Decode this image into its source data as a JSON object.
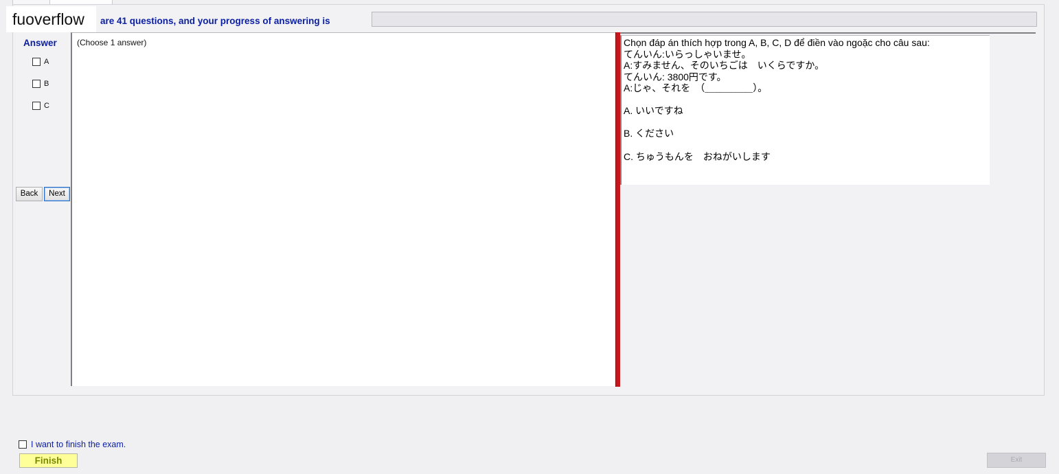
{
  "watermark": "fuoverflow",
  "progress": {
    "label": "are 41 questions, and your progress of answering is",
    "value": 0
  },
  "answer": {
    "title": "Answer",
    "options": [
      {
        "label": "A",
        "checked": false
      },
      {
        "label": "B",
        "checked": false
      },
      {
        "label": "C",
        "checked": false
      }
    ]
  },
  "nav": {
    "back_label": "Back",
    "next_label": "Next"
  },
  "answer_area": {
    "hint": "(Choose 1 answer)"
  },
  "question": {
    "lines": [
      "Chọn đáp án thích hợp trong A, B, C, D để điền vào ngoặc cho câu sau:",
      "てんいん:いらっしゃいませ。",
      "A:すみません、そのいちごは　いくらですか。",
      "てんいん: 3800円です。",
      "A:じゃ、それを　（＿＿＿＿＿）。"
    ],
    "options": [
      "A.  いいですね",
      "B.  ください",
      "C.  ちゅうもんを　おねがいします"
    ]
  },
  "footer": {
    "finish_check_label": "I want to finish the exam.",
    "finish_label": "Finish",
    "exit_label": "Exit"
  },
  "colors": {
    "accent_text": "#0a1ea0",
    "splitter": "#c8161b",
    "finish_bg": "#ffff9a"
  }
}
